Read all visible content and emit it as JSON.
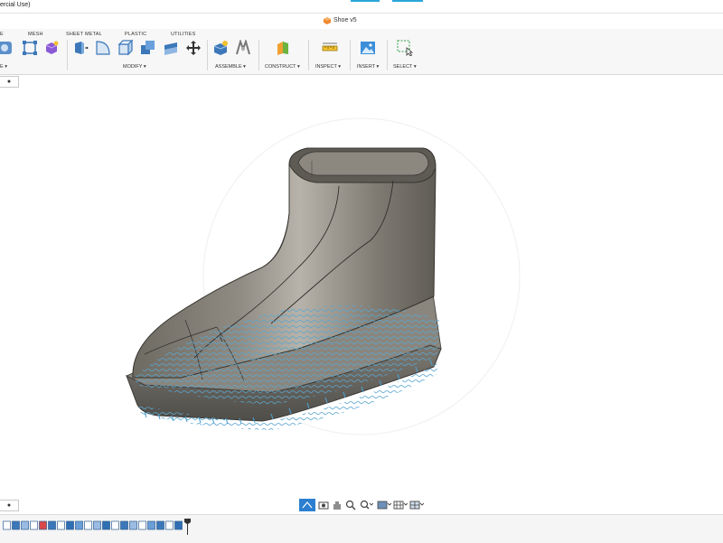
{
  "window": {
    "title": "ercial Use)",
    "document_tab": "Shoe v5",
    "accent": "#2aa7d9",
    "doc_icon_color": "#f0892f"
  },
  "ribbon": {
    "tabs": [
      "E",
      "MESH",
      "SHEET METAL",
      "PLASTIC",
      "UTILITIES"
    ],
    "groups": {
      "create": "E ▾",
      "modify": "MODIFY ▾",
      "assemble": "ASSEMBLE ▾",
      "construct": "CONSTRUCT ▾",
      "inspect": "INSPECT ▾",
      "insert": "INSERT ▾",
      "select": "SELECT ▾"
    }
  },
  "browser": {
    "toggle": "●"
  },
  "comments": {
    "toggle": "●"
  },
  "nav_icons": [
    "orbit-icon",
    "look-at-icon",
    "pan-icon",
    "zoom-icon",
    "fit-icon",
    "display-settings-icon",
    "grid-settings-icon",
    "viewports-icon"
  ],
  "timeline": {
    "feature_count": 20,
    "active_index": 4
  }
}
